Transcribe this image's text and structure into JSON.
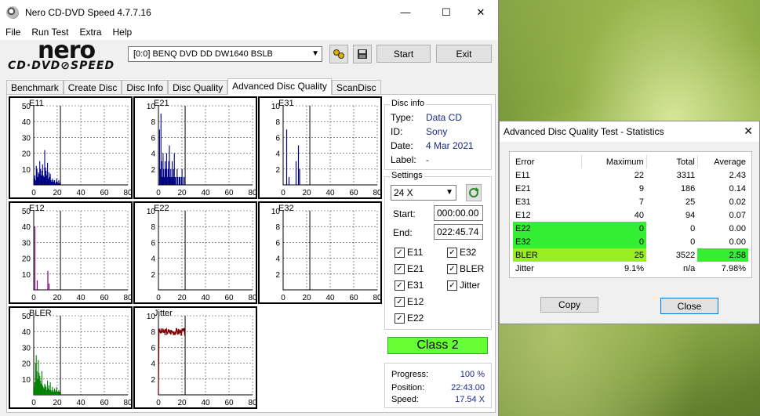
{
  "window": {
    "title": "Nero CD-DVD Speed 4.7.7.16",
    "min_glyph": "—",
    "max_glyph": "☐",
    "close_glyph": "✕"
  },
  "menu": [
    "File",
    "Run Test",
    "Extra",
    "Help"
  ],
  "logo": {
    "line1": "nero",
    "line2": "CD·DVD⊘SPEED"
  },
  "toolbar": {
    "drive": "[0:0]   BENQ DVD DD DW1640 BSLB",
    "start_label": "Start",
    "exit_label": "Exit"
  },
  "tabs": [
    "Benchmark",
    "Create Disc",
    "Disc Info",
    "Disc Quality",
    "Advanced Disc Quality",
    "ScanDisc"
  ],
  "active_tab": 4,
  "graphs": [
    {
      "label": "E11",
      "ymax": 50,
      "yticks": [
        "50",
        "40",
        "30",
        "20",
        "10"
      ],
      "xticks": [
        "0",
        "20",
        "40",
        "60",
        "80"
      ],
      "color": "#000080"
    },
    {
      "label": "E21",
      "ymax": 10,
      "yticks": [
        "10",
        "8",
        "6",
        "4",
        "2"
      ],
      "xticks": [
        "0",
        "20",
        "40",
        "60",
        "80"
      ],
      "color": "#000080"
    },
    {
      "label": "E31",
      "ymax": 10,
      "yticks": [
        "10",
        "8",
        "6",
        "4",
        "2"
      ],
      "xticks": [
        "0",
        "20",
        "40",
        "60",
        "80"
      ],
      "color": "#000080"
    },
    {
      "label": "E12",
      "ymax": 50,
      "yticks": [
        "50",
        "40",
        "30",
        "20",
        "10"
      ],
      "xticks": [
        "0",
        "20",
        "40",
        "60",
        "80"
      ],
      "color": "#800080"
    },
    {
      "label": "E22",
      "ymax": 10,
      "yticks": [
        "10",
        "8",
        "6",
        "4",
        "2"
      ],
      "xticks": [
        "0",
        "20",
        "40",
        "60",
        "80"
      ],
      "color": "#800080"
    },
    {
      "label": "E32",
      "ymax": 10,
      "yticks": [
        "10",
        "8",
        "6",
        "4",
        "2"
      ],
      "xticks": [
        "0",
        "20",
        "40",
        "60",
        "80"
      ],
      "color": "#800080"
    },
    {
      "label": "BLER",
      "ymax": 50,
      "yticks": [
        "50",
        "40",
        "30",
        "20",
        "10"
      ],
      "xticks": [
        "0",
        "20",
        "40",
        "60",
        "80"
      ],
      "color": "#008000"
    },
    {
      "label": "Jitter",
      "ymax": 10,
      "yticks": [
        "10",
        "8",
        "6",
        "4",
        "2"
      ],
      "xticks": [
        "0",
        "20",
        "40",
        "60",
        "80"
      ],
      "color": "#800000"
    }
  ],
  "chart_data": [
    {
      "type": "bar",
      "title": "E11",
      "x_end": 22.7,
      "xlim": [
        0,
        80
      ],
      "ylim": [
        0,
        50
      ],
      "peak": 22,
      "avg": 2.43,
      "profile": [
        4,
        6,
        3,
        12,
        10,
        5,
        8,
        7,
        15,
        10,
        6,
        9,
        13,
        6,
        5,
        22,
        11,
        9,
        6,
        14,
        4,
        8,
        5,
        7,
        3,
        2,
        4,
        3,
        2,
        3,
        1,
        2,
        4,
        2,
        1,
        3,
        1,
        2
      ]
    },
    {
      "type": "bar",
      "title": "E21",
      "x_end": 22.7,
      "xlim": [
        0,
        80
      ],
      "ylim": [
        0,
        10
      ],
      "peak": 9,
      "avg": 0.14,
      "profile": [
        0,
        7,
        2,
        9,
        3,
        1,
        4,
        2,
        1,
        3,
        2,
        4,
        1,
        2,
        3,
        5,
        1,
        2,
        1,
        3,
        1,
        2,
        4,
        1,
        1,
        0,
        2,
        1,
        0,
        1,
        1,
        0,
        1,
        2,
        0,
        1,
        0,
        1
      ]
    },
    {
      "type": "bar",
      "title": "E31",
      "x_end": 22.7,
      "xlim": [
        0,
        80
      ],
      "ylim": [
        0,
        10
      ],
      "spikes": [
        [
          3,
          7
        ],
        [
          5,
          1
        ],
        [
          11,
          3
        ],
        [
          13,
          5
        ],
        [
          14,
          2
        ]
      ]
    },
    {
      "type": "bar",
      "title": "E12",
      "x_end": 22.7,
      "xlim": [
        0,
        80
      ],
      "ylim": [
        0,
        50
      ],
      "spikes": [
        [
          1,
          40
        ],
        [
          3,
          6
        ],
        [
          12,
          12
        ],
        [
          13,
          4
        ]
      ]
    },
    {
      "type": "bar",
      "title": "E22",
      "x_end": 22.7,
      "xlim": [
        0,
        80
      ],
      "ylim": [
        0,
        10
      ],
      "spikes": []
    },
    {
      "type": "bar",
      "title": "E32",
      "x_end": 22.7,
      "xlim": [
        0,
        80
      ],
      "ylim": [
        0,
        10
      ],
      "spikes": []
    },
    {
      "type": "bar",
      "title": "BLER",
      "x_end": 22.7,
      "xlim": [
        0,
        80
      ],
      "ylim": [
        0,
        50
      ],
      "peak": 25,
      "avg": 2.58,
      "profile": [
        5,
        8,
        20,
        25,
        15,
        10,
        22,
        14,
        12,
        9,
        7,
        15,
        6,
        5,
        4,
        7,
        6,
        5,
        3,
        9,
        4,
        6,
        3,
        8,
        3,
        2,
        5,
        3,
        2,
        4,
        2,
        3,
        5,
        2,
        2,
        3,
        2,
        2
      ]
    },
    {
      "type": "line",
      "title": "Jitter",
      "x_end": 22.7,
      "xlim": [
        0,
        80
      ],
      "ylim": [
        0,
        10
      ],
      "level": 7.98,
      "max": 9.1
    }
  ],
  "disc_info": {
    "title": "Disc info",
    "rows": [
      {
        "k": "Type:",
        "v": "Data CD"
      },
      {
        "k": "ID:",
        "v": "Sony"
      },
      {
        "k": "Date:",
        "v": "4 Mar 2021"
      },
      {
        "k": "Label:",
        "v": "-"
      }
    ]
  },
  "settings": {
    "title": "Settings",
    "speed": "24 X",
    "start_label": "Start:",
    "start_value": "000:00.00",
    "end_label": "End:",
    "end_value": "022:45.74",
    "checks": [
      {
        "label": "E11",
        "checked": true
      },
      {
        "label": "E32",
        "checked": true
      },
      {
        "label": "E21",
        "checked": true
      },
      {
        "label": "BLER",
        "checked": true
      },
      {
        "label": "E31",
        "checked": true
      },
      {
        "label": "Jitter",
        "checked": true
      },
      {
        "label": "E12",
        "checked": true
      },
      {
        "label": "E22",
        "checked": true
      }
    ]
  },
  "class_label": "Class 2",
  "progress": {
    "rows": [
      {
        "k": "Progress:",
        "v": "100 %"
      },
      {
        "k": "Position:",
        "v": "22:43.00"
      },
      {
        "k": "Speed:",
        "v": "17.54 X"
      }
    ]
  },
  "dialog": {
    "title": "Advanced Disc Quality Test - Statistics",
    "close_glyph": "✕",
    "headers": [
      "Error",
      "Maximum",
      "Total",
      "Average"
    ],
    "rows": [
      {
        "e": "E11",
        "max": "22",
        "total": "3311",
        "avg": "2.43",
        "hl": ""
      },
      {
        "e": "E21",
        "max": "9",
        "total": "186",
        "avg": "0.14",
        "hl": ""
      },
      {
        "e": "E31",
        "max": "7",
        "total": "25",
        "avg": "0.02",
        "hl": ""
      },
      {
        "e": "E12",
        "max": "40",
        "total": "94",
        "avg": "0.07",
        "hl": ""
      },
      {
        "e": "E22",
        "max": "0",
        "total": "0",
        "avg": "0.00",
        "hl": "green"
      },
      {
        "e": "E32",
        "max": "0",
        "total": "0",
        "avg": "0.00",
        "hl": "green"
      },
      {
        "e": "BLER",
        "max": "25",
        "total": "3522",
        "avg": "2.58",
        "hl": "bler"
      },
      {
        "e": "Jitter",
        "max": "9.1%",
        "total": "n/a",
        "avg": "7.98%",
        "hl": ""
      }
    ],
    "copy_label": "Copy",
    "close_label": "Close"
  }
}
